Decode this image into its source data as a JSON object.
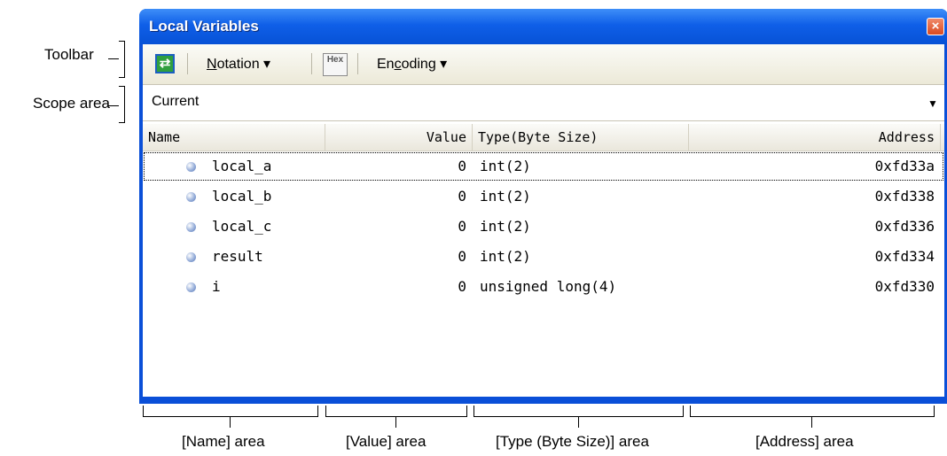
{
  "window": {
    "title": "Local Variables",
    "close_glyph": "×"
  },
  "toolbar": {
    "refresh_icon": "refresh-icon",
    "refresh_glyph": "⇄",
    "notation_label_pre": "",
    "notation_label_ul": "N",
    "notation_label_post": "otation ▾",
    "hex_label": "Hex",
    "encoding_label_pre": "En",
    "encoding_label_ul": "c",
    "encoding_label_post": "oding ▾"
  },
  "scope": {
    "value": "Current",
    "arrow": "▼"
  },
  "grid": {
    "columns": [
      "Name",
      "Value",
      "Type(Byte Size)",
      "Address"
    ],
    "rows": [
      {
        "name": "local_a",
        "value": "0",
        "type": "int(2)",
        "address": "0xfd33a"
      },
      {
        "name": "local_b",
        "value": "0",
        "type": "int(2)",
        "address": "0xfd338"
      },
      {
        "name": "local_c",
        "value": "0",
        "type": "int(2)",
        "address": "0xfd336"
      },
      {
        "name": "result",
        "value": "0",
        "type": "int(2)",
        "address": "0xfd334"
      },
      {
        "name": "i",
        "value": "0",
        "type": "unsigned long(4)",
        "address": "0xfd330"
      }
    ]
  },
  "callouts": {
    "toolbar": "Toolbar",
    "scope_area": "Scope area",
    "name_area": "[Name] area",
    "value_area": "[Value] area",
    "type_area": "[Type (Byte Size)] area",
    "address_area": "[Address] area"
  },
  "colors": {
    "titlebar": "#0f5fe8",
    "frame": "#0a4fd8",
    "close": "#d94a21"
  }
}
